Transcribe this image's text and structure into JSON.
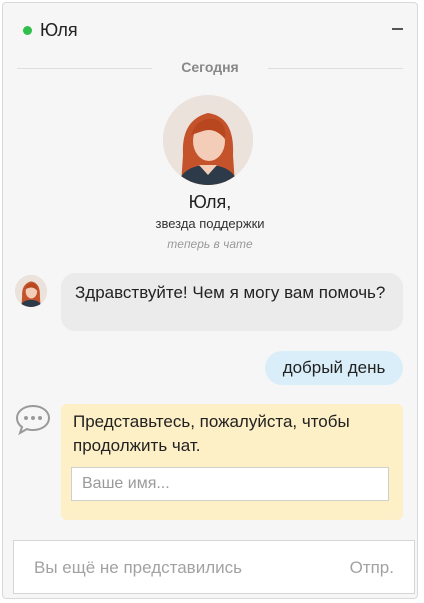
{
  "header": {
    "agent_name": "Юля",
    "status_color": "#2fbf4a",
    "minimize_icon": "minus-icon"
  },
  "divider": {
    "label": "Сегодня"
  },
  "agent_card": {
    "name": "Юля,",
    "role": "звезда поддержки",
    "status": "теперь в чате"
  },
  "messages": [
    {
      "from": "agent",
      "text": "Здравствуйте! Чем я могу вам помочь?"
    },
    {
      "from": "user",
      "text": "добрый день"
    }
  ],
  "intro_prompt": {
    "icon": "chat-bubble-icon",
    "text": "Представьтесь, пожалуйста, чтобы продолжить чат.",
    "name_placeholder": "Ваше имя..."
  },
  "composer": {
    "placeholder": "Вы ещё не представились",
    "send_label": "Отпр."
  },
  "colors": {
    "agent_bubble": "#ebebeb",
    "user_bubble": "#d9eef8",
    "prompt_card": "#fdefc6"
  }
}
